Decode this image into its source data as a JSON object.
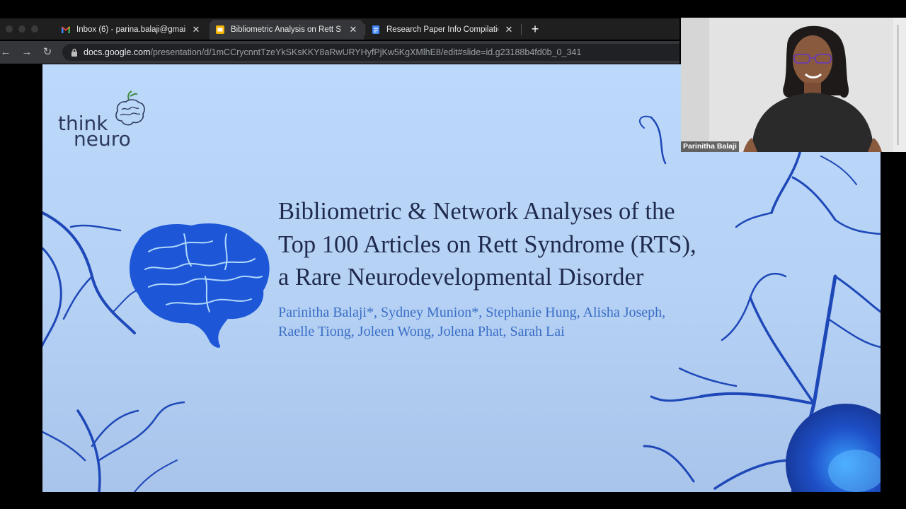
{
  "browser": {
    "tabs": [
      {
        "label": "Inbox (6) - parina.balaji@gmail",
        "icon": "gmail-icon",
        "active": false
      },
      {
        "label": "Bibliometric Analysis on Rett S",
        "icon": "google-slides-icon",
        "active": true
      },
      {
        "label": "Research Paper Info Compilatio",
        "icon": "google-docs-icon",
        "active": false
      }
    ],
    "address": {
      "domain": "docs.google.com",
      "path": "/presentation/d/1mCCrycnntTzeYkSKsKKY8aRwURYHyfPjKw5KgXMlhE8/edit#slide=id.g23188b4fd0b_0_341"
    }
  },
  "slide": {
    "logo": {
      "line1": "think",
      "line2": "neuro"
    },
    "title_lines": [
      "Bibliometric & Network Analyses of the",
      "Top 100 Articles on Rett Syndrome (RTS),",
      "a Rare Neurodevelopmental Disorder"
    ],
    "author_lines": [
      "Parinitha Balaji*, Sydney Munion*, Stephanie Hung, Alisha Joseph,",
      "Raelle Tiong, Joleen Wong, Jolena Phat, Sarah Lai"
    ]
  },
  "webcam": {
    "participant_name": "Parinitha Balaji"
  },
  "colors": {
    "slide_bg": "#bcd8fa",
    "title": "#1f2a4d",
    "authors": "#3a6ec6",
    "neuron": "#1e48b8"
  }
}
